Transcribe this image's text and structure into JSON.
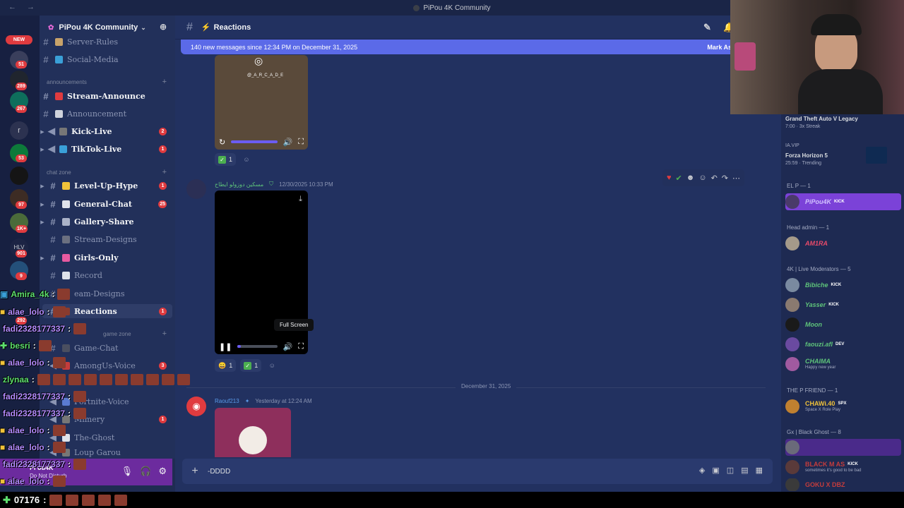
{
  "window": {
    "title": "PiPou 4K Community",
    "nav": "← →"
  },
  "rail": {
    "new_label": "NEW",
    "badges": [
      "51",
      "289",
      "267",
      "",
      "53",
      "",
      "97",
      "1K+",
      "901",
      "9",
      "292"
    ],
    "letter": "r",
    "hiv_label": "HLV"
  },
  "server": {
    "name": "PiPou 4K Community",
    "chevron": "⌄",
    "invite_icon": "person-add-icon"
  },
  "channels": {
    "items": [
      {
        "label": "Server-Rules",
        "count": ""
      },
      {
        "label": "Social-Media",
        "count": ""
      },
      {
        "label": "Stream-Announce",
        "count": ""
      },
      {
        "label": "Announcement",
        "count": ""
      },
      {
        "label": "Kick-Live",
        "count": "2"
      },
      {
        "label": "TikTok-Live",
        "count": "1"
      },
      {
        "label": "Level-Up-Hype",
        "count": "1"
      },
      {
        "label": "General-Chat",
        "count": "25"
      },
      {
        "label": "Gallery-Share",
        "count": ""
      },
      {
        "label": "Stream-Designs",
        "count": ""
      },
      {
        "label": "Girls-Only",
        "count": ""
      },
      {
        "label": "Record",
        "count": ""
      },
      {
        "label": "eam-Designs",
        "count": ""
      },
      {
        "label": "Reactions",
        "count": "1"
      },
      {
        "label": "Game-Chat",
        "count": ""
      },
      {
        "label": "AmongUs-Voice",
        "count": "3"
      },
      {
        "label": "Fortnite-Voice",
        "count": ""
      },
      {
        "label": "Mimery",
        "count": "1"
      },
      {
        "label": "The-Ghost",
        "count": ""
      },
      {
        "label": "Loup Garou",
        "count": ""
      }
    ],
    "categories": [
      "announcements",
      "chat zone",
      "game zone"
    ]
  },
  "userbar": {
    "status": "Do Not Disturb",
    "name": "Pi ou4K"
  },
  "chat": {
    "channel": "Reactions",
    "new_messages": "140 new messages since 12:34 PM on December 31, 2025",
    "mark_read": "Mark As",
    "video1": {
      "watermark": "@_A_R_C_A_D_E",
      "reaction_count": "1"
    },
    "msg2": {
      "author": "مسكين دوزولو ايطاح",
      "timestamp": "12/30/2025 10:33 PM",
      "reactions": [
        "1",
        "1"
      ]
    },
    "tooltip": "Full Screen",
    "divider": "December 31, 2025",
    "msg3": {
      "author": "Raouf213",
      "timestamp": "Yesterday at 12:24 AM"
    },
    "composer_text": "-DDDD"
  },
  "members": {
    "top_game1": {
      "title": "Grand Theft Auto V Legacy",
      "sub": "7:00 · 3x Streak"
    },
    "top_game2": {
      "title": "Forza Horizon 5",
      "sub": "25:59 · Trending",
      "tag": "IA.VIP"
    },
    "groups": [
      {
        "label": "EL P — 1"
      },
      {
        "label": "Head admin — 1"
      },
      {
        "label": "4K | Live Moderators — 5"
      },
      {
        "label": "THE P FRIEND — 1"
      },
      {
        "label": "Gx | Black Ghost — 8"
      }
    ],
    "list": [
      {
        "name": "PiPou4K",
        "tag": "KICK",
        "color": "#b9a4ff"
      },
      {
        "name": "AM1RA",
        "tag": "",
        "color": "#e84a6a"
      },
      {
        "name": "Bibiche",
        "tag": "KICK",
        "color": "#5ec37a"
      },
      {
        "name": "Yasser",
        "tag": "KICK",
        "color": "#5ec37a"
      },
      {
        "name": "Moon",
        "tag": "",
        "color": "#5ec37a"
      },
      {
        "name": "faouzi.afl",
        "tag": "DEV",
        "color": "#5ec37a"
      },
      {
        "name": "CHAIMA",
        "tag": "",
        "color": "#5ec37a",
        "sub": "Happy new year"
      },
      {
        "name": "CHAWi.40",
        "tag": "SPX",
        "color": "#f0c23a",
        "sub": "Space X Role Play"
      },
      {
        "name": "BLACK M AS",
        "tag": "KICK",
        "color": "#c43c3c",
        "sub": "sometimes it's good to be bad"
      },
      {
        "name": "GOKU X DBZ",
        "tag": "",
        "color": "#c43c3c"
      }
    ]
  },
  "overlay": {
    "lines": [
      {
        "user": "Amira_4k",
        "sep": ":",
        "color": "#5ee06e"
      },
      {
        "user": "alae_lolo",
        "sep": ":",
        "color": "#b58cff"
      },
      {
        "user": "fadi2328177337",
        "sep": ":",
        "color": "#b58cff"
      },
      {
        "user": "besri",
        "sep": ":",
        "color": "#5ee06e"
      },
      {
        "user": "alae_lolo",
        "sep": ":",
        "color": "#b58cff"
      },
      {
        "user": "zlynaa",
        "sep": ":",
        "color": "#5ee06e"
      },
      {
        "user": "fadi2328177337",
        "sep": ":",
        "color": "#b58cff"
      },
      {
        "user": "fadi2328177337",
        "sep": ":",
        "color": "#b58cff"
      },
      {
        "user": "alae_lolo",
        "sep": ":",
        "color": "#b58cff"
      },
      {
        "user": "alae_lolo",
        "sep": ":",
        "color": "#b58cff"
      },
      {
        "user": "fadi2328177337",
        "sep": ":",
        "color": "#b58cff"
      },
      {
        "user": "alae_lolo",
        "sep": ":",
        "color": "#b58cff"
      }
    ],
    "bottom_user": "07176",
    "bottom_sep": ":"
  }
}
